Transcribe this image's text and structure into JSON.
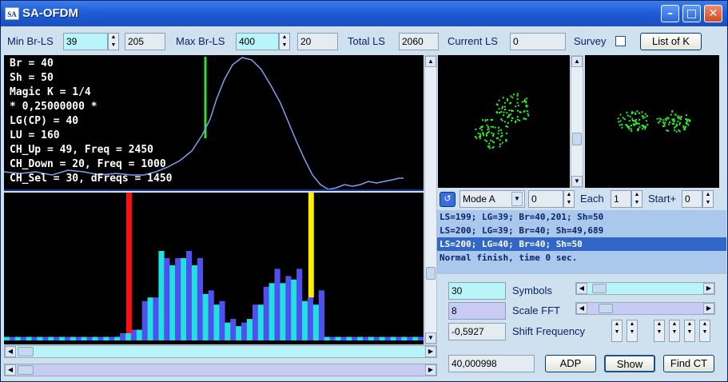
{
  "window": {
    "title": "SA-OFDM",
    "icon_text": "SA"
  },
  "toolbar": {
    "min_br_ls_label": "Min Br-LS",
    "min_br_ls_value": "39",
    "min_br_ls_aux": "205",
    "max_br_ls_label": "Max Br-LS",
    "max_br_ls_value": "400",
    "max_br_ls_aux": "20",
    "total_ls_label": "Total LS",
    "total_ls_value": "2060",
    "current_ls_label": "Current LS",
    "current_ls_value": "0",
    "survey_label": "Survey",
    "list_of_k_label": "List of K"
  },
  "info_lines": [
    "Br = 40",
    "Sh = 50",
    "Magic K = 1/4",
    "* 0,25000000 *",
    "LG(CP) = 40",
    "LU = 160",
    "CH_Up = 49, Freq = 2450",
    "CH_Down = 20, Freq = 1000",
    "CH_Sel = 30, dFreqs = 1450"
  ],
  "spectrum": {
    "bars": [
      1,
      1,
      1,
      1,
      1,
      1,
      1,
      1,
      1,
      1,
      1,
      1,
      1,
      1,
      1,
      1,
      1,
      1,
      1,
      1,
      1,
      2,
      2,
      3,
      3,
      11,
      12,
      12,
      25,
      23,
      21,
      23,
      23,
      25,
      21,
      23,
      13,
      14,
      10,
      11,
      5,
      6,
      4,
      5,
      6,
      10,
      10,
      15,
      16,
      20,
      16,
      18,
      17,
      20,
      11,
      12,
      10,
      14,
      1,
      1,
      1,
      1,
      1,
      1,
      1,
      1,
      1,
      1,
      1,
      1,
      1,
      1,
      1,
      1,
      1,
      1
    ],
    "red_index": 22,
    "yellow_index": 55
  },
  "controls": {
    "mode_label": "Mode A",
    "mode_value": "0",
    "each_label": "Each",
    "each_value": "1",
    "start_label": "Start+",
    "start_value": "0"
  },
  "log": [
    "LS=199; LG=39; Br=40,201; Sh=50",
    "LS=200; LG=39; Br=40; Sh=49,689",
    "LS=200; LG=40; Br=40; Sh=50",
    "Normal finish, time 0 sec."
  ],
  "params": {
    "symbols_value": "30",
    "symbols_label": "Symbols",
    "scale_fft_value": "8",
    "scale_fft_label": "Scale FFT",
    "shift_freq_value": "-0,5927",
    "shift_freq_label": "Shift Frequency"
  },
  "bottom": {
    "readout": "40,000998",
    "adp_label": "ADP",
    "show_label": "Show",
    "find_ct_label": "Find CT"
  },
  "colors": {
    "accent": "#1e5bd6",
    "cyan": "#20e0e0",
    "violet": "#5050f0",
    "green": "#30f030"
  }
}
